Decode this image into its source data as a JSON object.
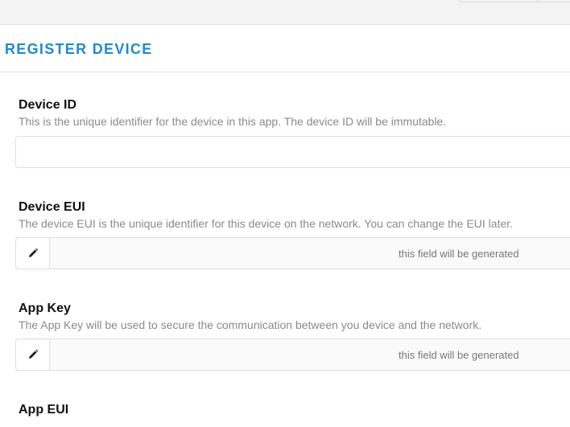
{
  "header": {
    "title": "REGISTER DEVICE"
  },
  "fields": [
    {
      "label": "Device ID",
      "description": "This is the unique identifier for the device in this app. The device ID will be immutable.",
      "value": ""
    },
    {
      "label": "Device EUI",
      "description": "The device EUI is the unique identifier for this device on the network. You can change the EUI later.",
      "placeholder": "this field will be generated",
      "icon": "pencil-icon"
    },
    {
      "label": "App Key",
      "description": "The App Key will be used to secure the communication between you device and the network.",
      "placeholder": "this field will be generated",
      "icon": "pencil-icon"
    },
    {
      "label": "App EUI"
    }
  ],
  "colors": {
    "accent": "#1f8bcf",
    "label": "#111111",
    "description": "#8a8a8a",
    "border": "#dedede"
  }
}
